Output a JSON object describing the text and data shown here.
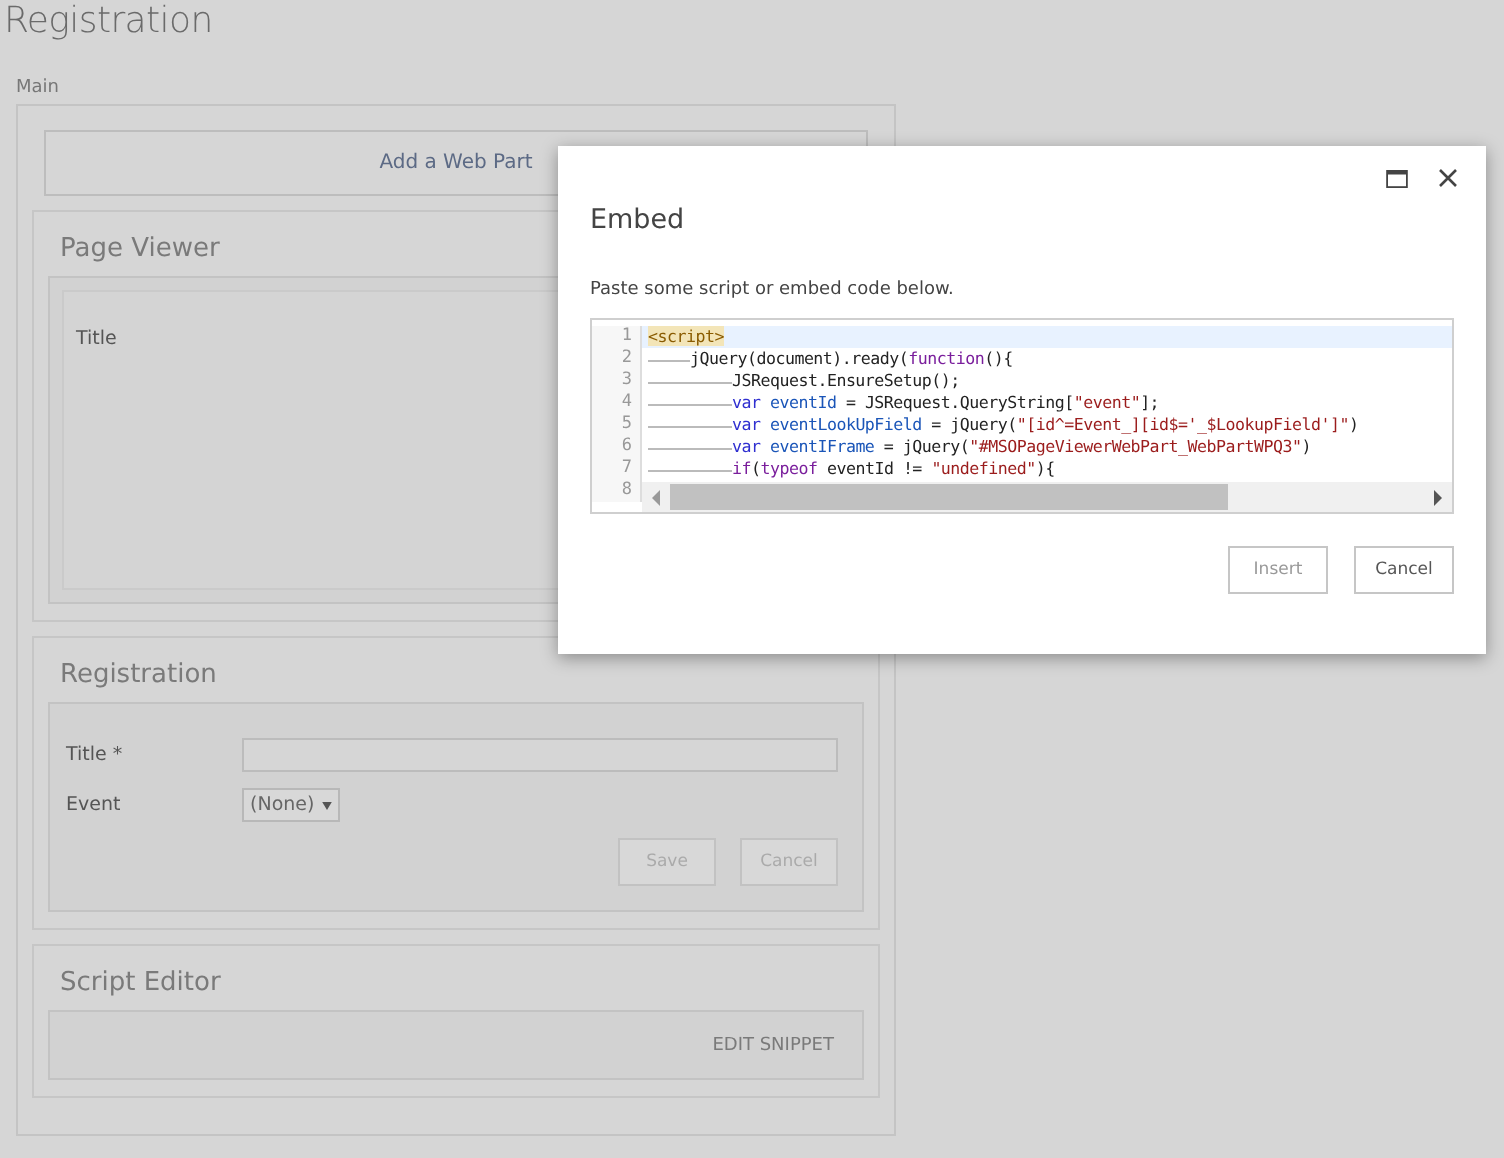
{
  "page": {
    "title": "Registration",
    "zone_label": "Main",
    "add_web_part": "Add a Web Part"
  },
  "web_parts": [
    {
      "kind": "page_viewer",
      "title": "Page Viewer",
      "field_label": "Title"
    },
    {
      "kind": "form",
      "title": "Registration",
      "fields": [
        {
          "kind": "text",
          "label": "Title *"
        },
        {
          "kind": "select",
          "label": "Event",
          "value": "(None)"
        }
      ],
      "buttons": [
        {
          "label": "Save",
          "disabled": true
        },
        {
          "label": "Cancel",
          "disabled": true
        }
      ]
    },
    {
      "kind": "script_editor",
      "title": "Script Editor",
      "action": "EDIT SNIPPET"
    }
  ],
  "dialog": {
    "title": "Embed",
    "instruction": "Paste some script or embed code below.",
    "code_lines": [
      {
        "number": "1",
        "active": true,
        "tokens": [
          {
            "kind": "tag",
            "text": "<script>"
          }
        ]
      },
      {
        "number": "2",
        "active": false,
        "tokens": [
          {
            "kind": "tab"
          },
          {
            "kind": "plain",
            "text": "jQuery(document).ready("
          },
          {
            "kind": "keyword",
            "text": "function"
          },
          {
            "kind": "plain",
            "text": "(){"
          }
        ]
      },
      {
        "number": "3",
        "active": false,
        "tokens": [
          {
            "kind": "tab"
          },
          {
            "kind": "tab"
          },
          {
            "kind": "plain",
            "text": "JSRequest.EnsureSetup();"
          }
        ]
      },
      {
        "number": "4",
        "active": false,
        "tokens": [
          {
            "kind": "tab"
          },
          {
            "kind": "tab"
          },
          {
            "kind": "var",
            "text": "var "
          },
          {
            "kind": "def",
            "text": "eventId"
          },
          {
            "kind": "plain",
            "text": " = JSRequest.QueryString["
          },
          {
            "kind": "string",
            "text": "\"event\""
          },
          {
            "kind": "plain",
            "text": "];"
          }
        ]
      },
      {
        "number": "5",
        "active": false,
        "tokens": [
          {
            "kind": "tab"
          },
          {
            "kind": "tab"
          },
          {
            "kind": "var",
            "text": "var "
          },
          {
            "kind": "def",
            "text": "eventLookUpField"
          },
          {
            "kind": "plain",
            "text": " = jQuery("
          },
          {
            "kind": "string",
            "text": "\"[id^=Event_][id$='_$LookupField']\""
          },
          {
            "kind": "plain",
            "text": ")"
          }
        ]
      },
      {
        "number": "6",
        "active": false,
        "tokens": [
          {
            "kind": "tab"
          },
          {
            "kind": "tab"
          },
          {
            "kind": "var",
            "text": "var "
          },
          {
            "kind": "def",
            "text": "eventIFrame"
          },
          {
            "kind": "plain",
            "text": " = jQuery("
          },
          {
            "kind": "string",
            "text": "\"#MSOPageViewerWebPart_WebPartWPQ3\""
          },
          {
            "kind": "plain",
            "text": ")"
          }
        ]
      },
      {
        "number": "7",
        "active": false,
        "tokens": [
          {
            "kind": "tab"
          },
          {
            "kind": "tab"
          },
          {
            "kind": "keyword",
            "text": "if"
          },
          {
            "kind": "plain",
            "text": "("
          },
          {
            "kind": "keyword",
            "text": "typeof"
          },
          {
            "kind": "plain",
            "text": " eventId != "
          },
          {
            "kind": "string",
            "text": "\"undefined\""
          },
          {
            "kind": "plain",
            "text": "){"
          }
        ]
      },
      {
        "number": "8",
        "active": false
      }
    ],
    "buttons": [
      {
        "label": "Insert",
        "disabled": true
      },
      {
        "label": "Cancel",
        "disabled": false
      }
    ]
  }
}
